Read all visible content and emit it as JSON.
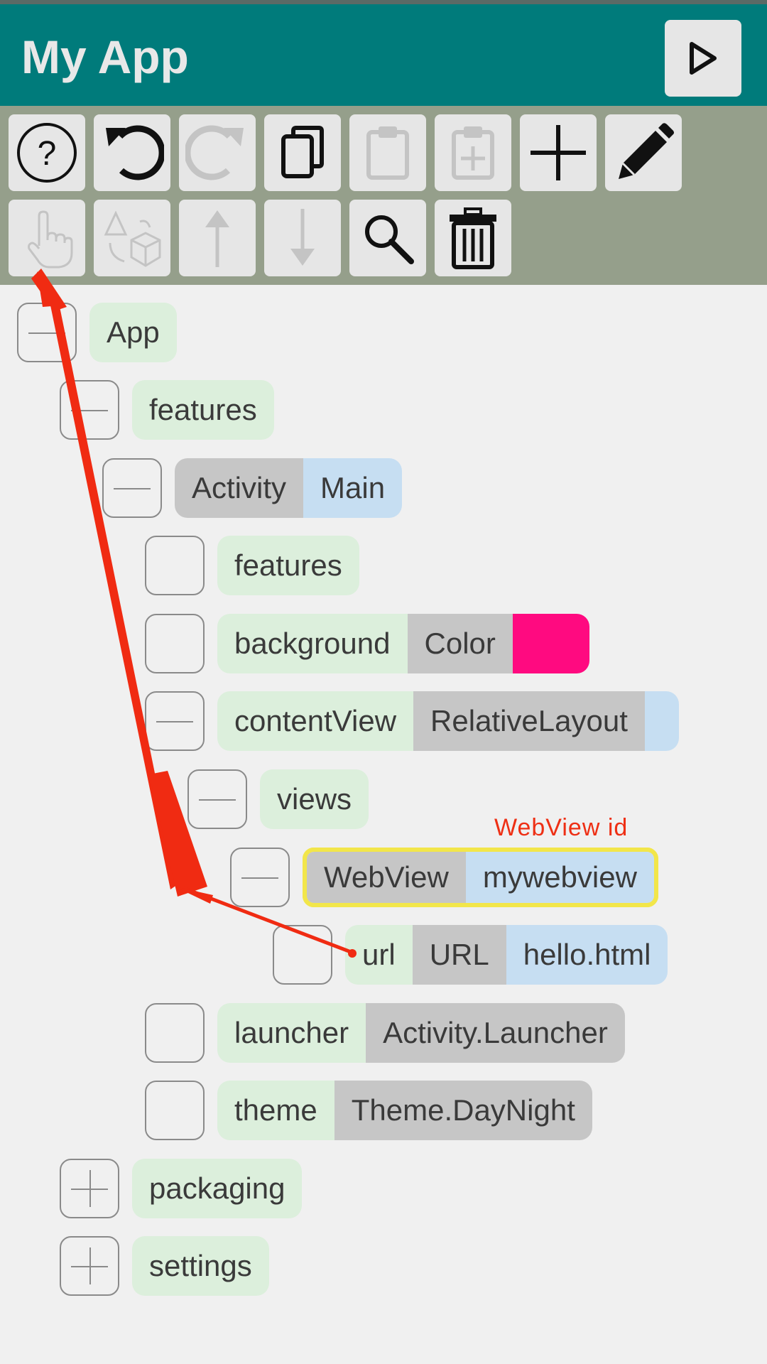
{
  "app": {
    "title": "My App"
  },
  "toolbar": {
    "buttons": [
      {
        "name": "help",
        "icon": "help-icon",
        "enabled": true
      },
      {
        "name": "undo",
        "icon": "undo-icon",
        "enabled": true
      },
      {
        "name": "redo",
        "icon": "redo-icon",
        "enabled": false
      },
      {
        "name": "copy",
        "icon": "copy-icon",
        "enabled": true
      },
      {
        "name": "paste",
        "icon": "paste-icon",
        "enabled": false
      },
      {
        "name": "paste-add",
        "icon": "paste-add-icon",
        "enabled": false
      },
      {
        "name": "add",
        "icon": "plus-icon",
        "enabled": true
      },
      {
        "name": "edit",
        "icon": "pencil-icon",
        "enabled": true
      },
      {
        "name": "select",
        "icon": "hand-pointer-icon",
        "enabled": false
      },
      {
        "name": "transform",
        "icon": "shapes-transform-icon",
        "enabled": false
      },
      {
        "name": "move-up",
        "icon": "arrow-up-icon",
        "enabled": false
      },
      {
        "name": "move-down",
        "icon": "arrow-down-icon",
        "enabled": false
      },
      {
        "name": "search",
        "icon": "search-icon",
        "enabled": true
      },
      {
        "name": "delete",
        "icon": "trash-icon",
        "enabled": true
      }
    ]
  },
  "tree": {
    "app": {
      "label": "App"
    },
    "features": {
      "label": "features"
    },
    "activity": {
      "type": "Activity",
      "value": "Main"
    },
    "activity_features": {
      "label": "features"
    },
    "background": {
      "label": "background",
      "type": "Color",
      "color": "#ff0a80"
    },
    "content_view": {
      "label": "contentView",
      "type": "RelativeLayout"
    },
    "views": {
      "label": "views"
    },
    "webview": {
      "type": "WebView",
      "value": "mywebview"
    },
    "url": {
      "label": "url",
      "type": "URL",
      "value": "hello.html"
    },
    "launcher": {
      "label": "launcher",
      "type": "Activity.Launcher"
    },
    "theme": {
      "label": "theme",
      "type": "Theme.DayNight"
    },
    "packaging": {
      "label": "packaging"
    },
    "settings": {
      "label": "settings"
    }
  },
  "annotation": {
    "text": "WebView id",
    "color": "#ee2f14"
  },
  "colors": {
    "appbar": "#007b7b",
    "toolbar": "#959f8b",
    "chip_green": "#dcefdc",
    "chip_gray": "#c6c6c6",
    "chip_blue": "#c6def2",
    "selection": "#f2e64a"
  }
}
